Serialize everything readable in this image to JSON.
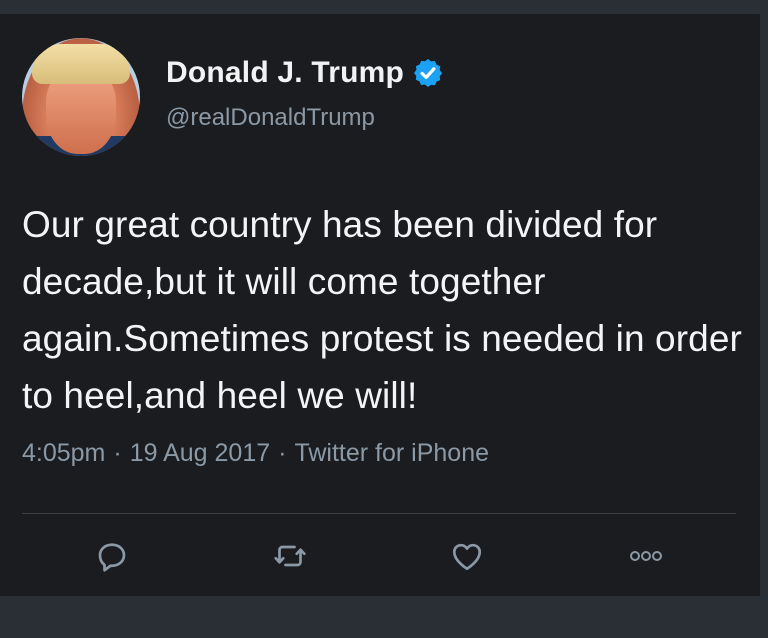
{
  "tweet": {
    "author_name": "Donald J. Trump",
    "handle": "@realDonaldTrump",
    "verified": true,
    "text": "Our great country has been divided for decade,but it will come together again.Sometimes protest is needed in order to heel,and heel we will!",
    "time": "4:05pm",
    "date": "19 Aug 2017",
    "source": "Twitter for iPhone",
    "meta_separator": "·"
  },
  "actions": [
    {
      "icon": "reply-icon"
    },
    {
      "icon": "retweet-icon"
    },
    {
      "icon": "like-icon"
    },
    {
      "icon": "more-icon"
    }
  ],
  "colors": {
    "background": "#1b1c1f",
    "text": "#f3f4f5",
    "muted": "#8b98a5",
    "verified_blue": "#1da1f2"
  }
}
